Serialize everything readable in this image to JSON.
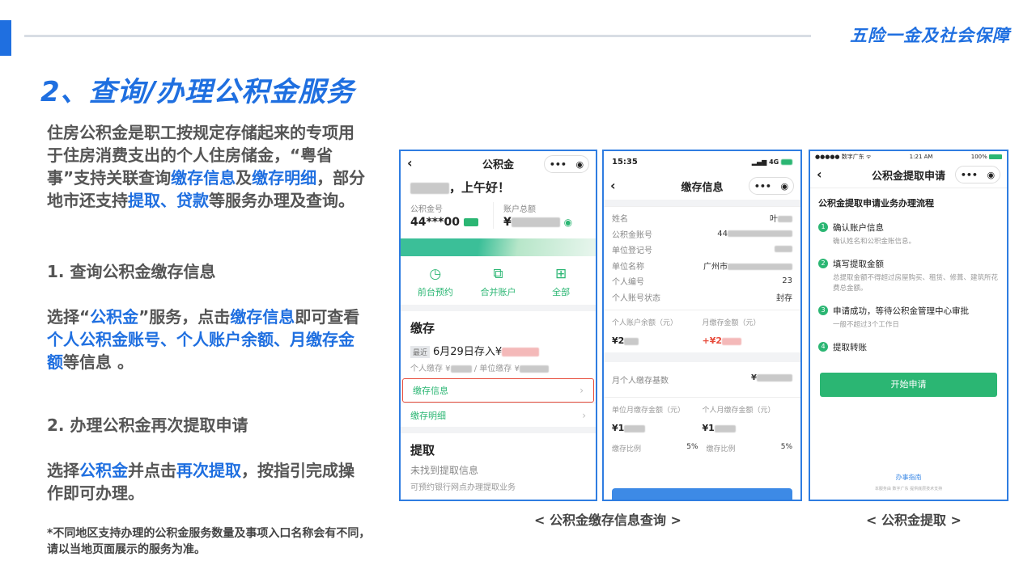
{
  "header": {
    "title": "五险一金及社会保障"
  },
  "slide": {
    "title": "2、查询/办理公积金服务",
    "intro": [
      "住房公积金是职工按规定存储起来的专项用于住房消费支出的个人住房储金，“粤省事”支持关联查询",
      "缴存信息",
      "及",
      "缴存明细",
      "，部分地市还支持",
      "提取、贷款",
      "等服务办理及查询。"
    ],
    "step1_heading": "1. 查询公积金缴存信息",
    "step1_body": [
      "选择“",
      "公积金",
      "”服务，点击",
      "缴存信息",
      "即可查看",
      "个人公积金账号、个人账户余额、月缴存金额",
      "等信息 。"
    ],
    "step2_heading": "2. 办理公积金再次提取申请",
    "step2_body": [
      "选择",
      "公积金",
      "并点击",
      "再次提取",
      "，按指引完成操作即可办理。"
    ],
    "note": "*不同地区支持办理的公积金服务数量及事项入口名称会有不同，请以当地页面展示的服务为准。",
    "caption_query": "< 公积金缴存信息查询 >",
    "caption_withdraw": "< 公积金提取 >"
  },
  "phone1": {
    "title": "公积金",
    "greeting": "，上午好！",
    "account_label": "公积金号",
    "account_value": "44***00",
    "balance_label": "账户总额",
    "balance_prefix": "¥",
    "icons": [
      {
        "label": "前台预约",
        "icon": "clock-icon",
        "glyph": "◷"
      },
      {
        "label": "合并账户",
        "icon": "merge-icon",
        "glyph": "⧉"
      },
      {
        "label": "全部",
        "icon": "grid-icon",
        "glyph": "⊞"
      }
    ],
    "deposit_heading": "缴存",
    "deposit_tag": "最近",
    "deposit_line": "6月29日存入¥",
    "deposit_sub_a": "个人缴存 ¥",
    "deposit_sub_b": "/ 单位缴存 ¥",
    "rows": [
      "缴存信息",
      "缴存明细"
    ],
    "withdraw_heading": "提取",
    "withdraw_status": "未找到提取信息",
    "withdraw_note": "可预约银行网点办理提取业务"
  },
  "phone2": {
    "time": "15:35",
    "network": "4G",
    "title": "缴存信息",
    "fields": [
      {
        "label": "姓名",
        "value": "叶"
      },
      {
        "label": "公积金账号",
        "value": "44"
      },
      {
        "label": "单位登记号",
        "value": ""
      },
      {
        "label": "单位名称",
        "value": "广州市"
      },
      {
        "label": "个人编号",
        "value": "23"
      },
      {
        "label": "个人账号状态",
        "value": "封存"
      }
    ],
    "balance_label": "个人账户余额（元）",
    "balance_value": "¥2",
    "monthly_label": "月缴存金额（元）",
    "monthly_value": "+¥2",
    "base_label": "月个人缴存基数",
    "base_value": "¥",
    "unit_monthly_label": "单位月缴存金额（元）",
    "unit_monthly_value": "¥1",
    "person_monthly_label": "个人月缴存金额（元）",
    "person_monthly_value": "¥1",
    "ratio_left_label": "缴存比例",
    "ratio_left_value": "5%",
    "ratio_right_label": "缴存比例",
    "ratio_right_value": "5%"
  },
  "phone3": {
    "carrier": "●●●●● 数字广东 ᯤ",
    "time": "1:21 AM",
    "battery": "100%",
    "title": "公积金提取申请",
    "process_title": "公积金提取申请业务办理流程",
    "steps": [
      {
        "n": "1",
        "title": "确认账户信息",
        "desc": "确认姓名和公积金账信息。"
      },
      {
        "n": "2",
        "title": "填写提取金额",
        "desc": "总提取金额不得超过房屋购买、租赁、修葺、建筑所花费总金额。"
      },
      {
        "n": "3",
        "title": "申请成功，等待公积金管理中心审批",
        "desc": "一般不超过3个工作日"
      },
      {
        "n": "4",
        "title": "提取转账",
        "desc": ""
      }
    ],
    "start_button": "开始申请",
    "guide": "办事指南",
    "footer": "本服务由 数字广东 提供底层技术支持"
  }
}
